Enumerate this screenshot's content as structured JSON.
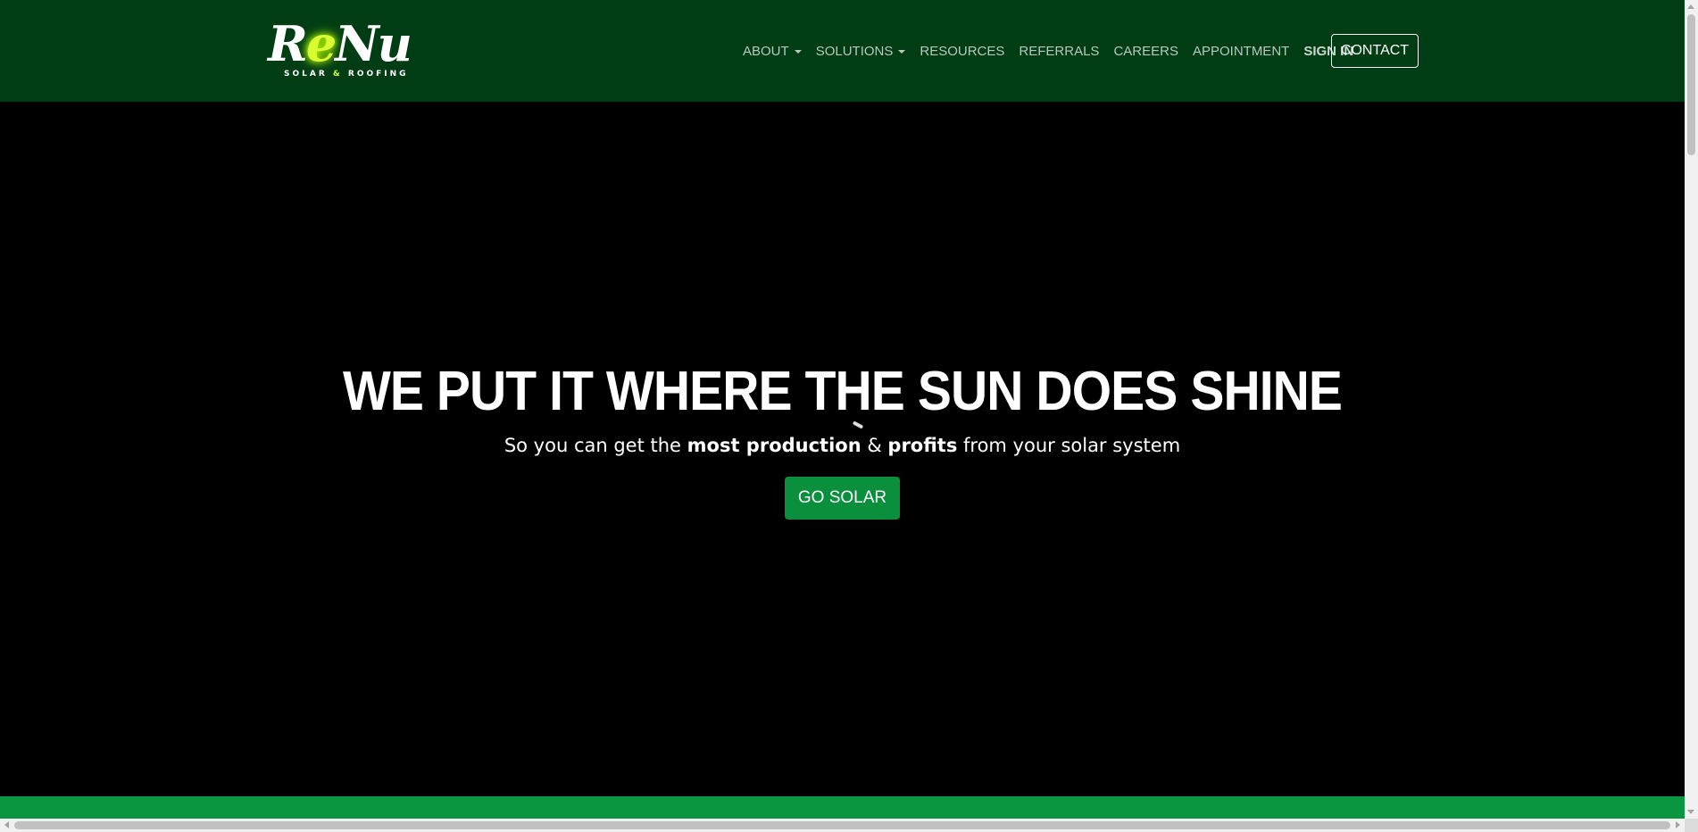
{
  "brand": {
    "logo_prefix": "R",
    "logo_glow": "e",
    "logo_suffix": "Nu",
    "tag_left": "SOLAR",
    "tag_amp": "&",
    "tag_right": "ROOFING"
  },
  "nav": {
    "items": [
      {
        "label": "ABOUT",
        "dropdown": true
      },
      {
        "label": "SOLUTIONS",
        "dropdown": true
      },
      {
        "label": "RESOURCES",
        "dropdown": false
      },
      {
        "label": "REFERRALS",
        "dropdown": false
      },
      {
        "label": "CAREERS",
        "dropdown": false
      },
      {
        "label": "APPOINTMENT",
        "dropdown": false
      },
      {
        "label": "SIGN IN",
        "dropdown": false
      }
    ],
    "contact_label": "CONTACT"
  },
  "hero": {
    "title_normal": "WE PUT IT WHERE THE SUN ",
    "title_bold": "DOES SHINE",
    "sub_part1": "So you can get the ",
    "sub_bold1": "most production",
    "sub_part2": " & ",
    "sub_bold2": "profits",
    "sub_part3": " from your solar system",
    "cta_label": "GO SOLAR"
  },
  "colors": {
    "navbar_bg": "#003d14",
    "accent_green": "#0a8f3c",
    "logo_glow": "#d9ff33"
  }
}
